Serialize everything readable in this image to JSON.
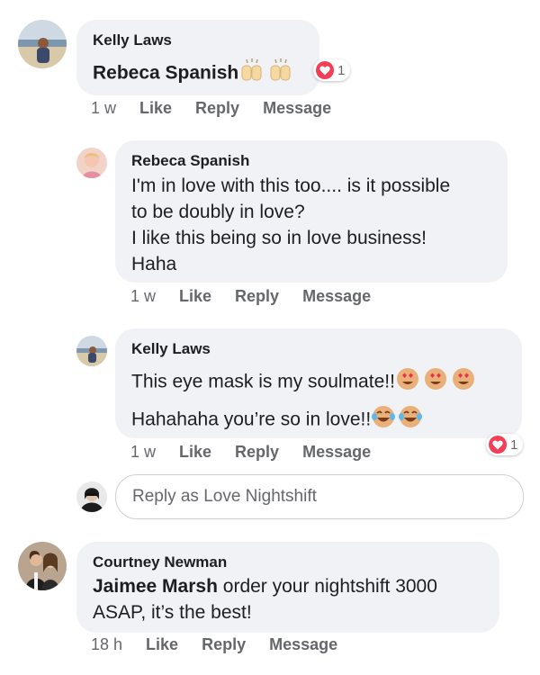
{
  "comments": [
    {
      "author": "Kelly Laws",
      "mention": "Rebeca Spanish",
      "text": "",
      "time": "1 w",
      "reaction_count": "1"
    },
    {
      "author": "Rebeca Spanish",
      "lines": [
        "I'm in love with this too.... is it possible",
        "to be doubly in love?",
        "I like this being so in love business!",
        "Haha"
      ],
      "time": "1 w"
    },
    {
      "author": "Kelly Laws",
      "lines": [
        "This eye mask is my soulmate!!",
        "Hahahaha you’re so in love!!"
      ],
      "time": "1 w",
      "reaction_count": "1"
    },
    {
      "author": "Courtney Newman",
      "mention": "Jaimee Marsh",
      "text_line1": "order your nightshift 3000",
      "text_line2": "ASAP, it’s the best!",
      "time": "18 h"
    }
  ],
  "actions": {
    "like": "Like",
    "reply": "Reply",
    "message": "Message"
  },
  "reply_box": {
    "placeholder": "Reply as Love Nightshift"
  },
  "colors": {
    "bubble": "#f0f2f5",
    "meta": "#65676b",
    "heart": "#f33e58"
  },
  "icons": [
    "heart-reaction-icon",
    "raising-hands-emoji-icon",
    "heart-eyes-emoji-icon",
    "tears-of-joy-emoji-icon"
  ]
}
